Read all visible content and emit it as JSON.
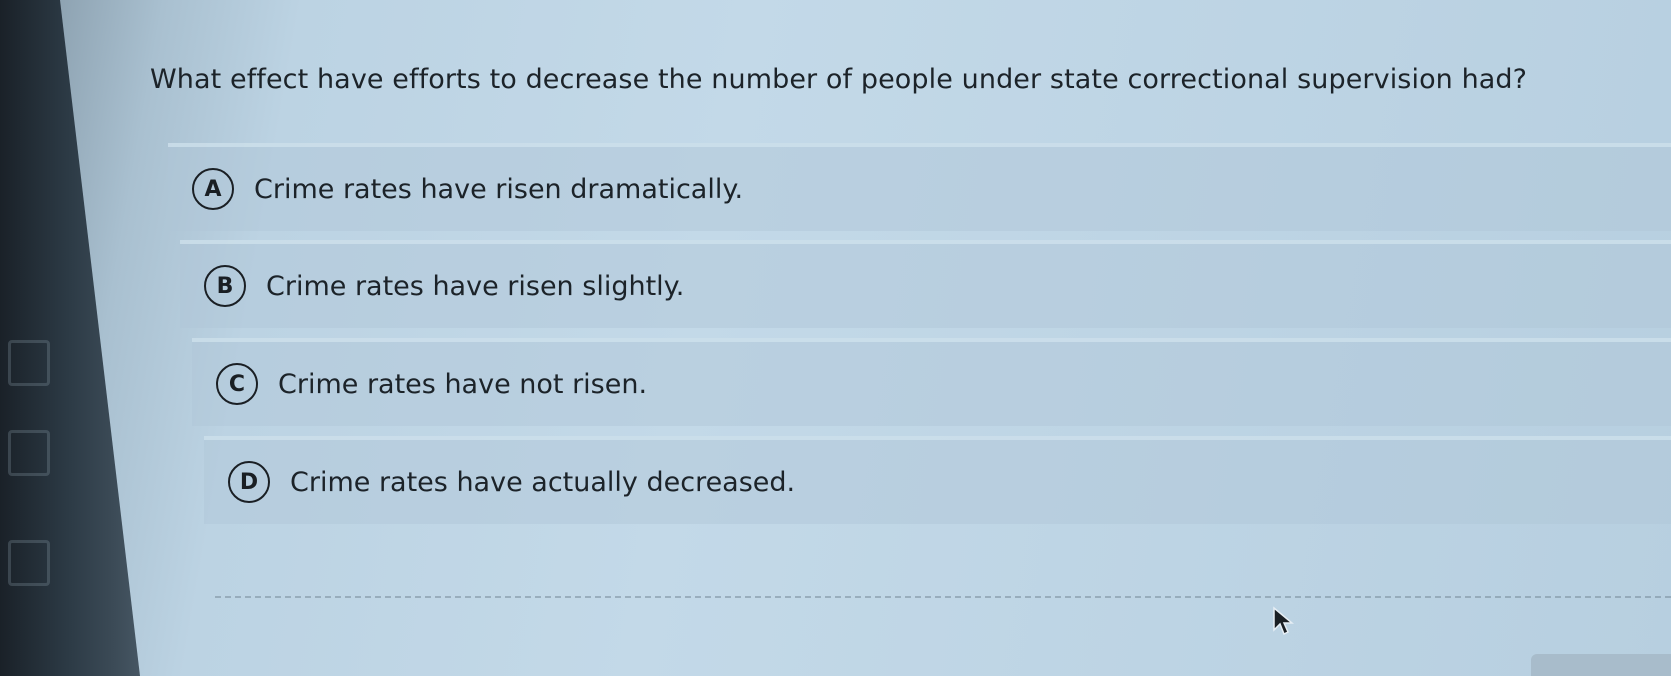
{
  "question": {
    "text": "What effect have efforts to decrease the number of people under state correctional supervision had?"
  },
  "choices": [
    {
      "letter": "A",
      "text": "Crime rates have risen dramatically."
    },
    {
      "letter": "B",
      "text": "Crime rates have risen slightly."
    },
    {
      "letter": "C",
      "text": "Crime rates have not risen."
    },
    {
      "letter": "D",
      "text": "Crime rates have actually decreased."
    }
  ],
  "icons": {
    "cursor": "mouse-pointer-icon"
  },
  "colors": {
    "screen_bg": "#c3d9e8",
    "text": "#1c2329"
  }
}
